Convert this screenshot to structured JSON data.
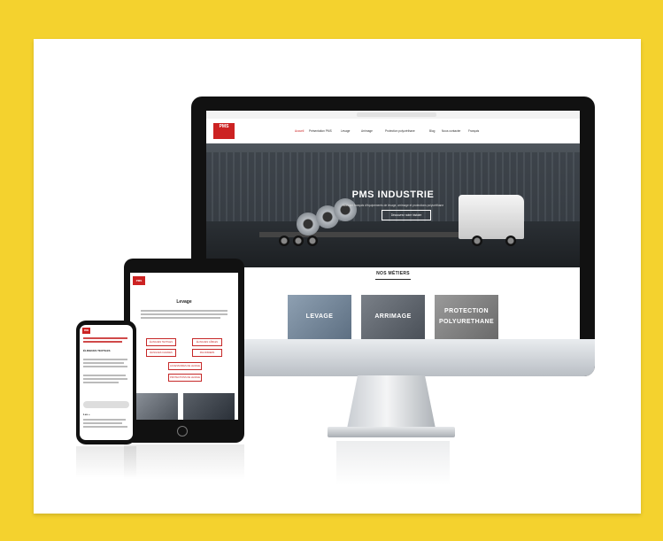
{
  "desktop": {
    "site": {
      "logo_text": "PMS",
      "nav": [
        "Accueil",
        "Présentation PMS",
        "Levage",
        "Arrimage",
        "Protection polyuréthane",
        "Blog",
        "Nous contacter",
        "Français"
      ],
      "hero_title": "PMS INDUSTRIE",
      "hero_subtitle": "fabricant français d'équipements de levage, arrimage et protections polyuréthane",
      "hero_button": "Découvrez notre histoire",
      "section_title": "NOS MÉTIERS",
      "tiles": [
        {
          "label": "LEVAGE",
          "label2": ""
        },
        {
          "label": "ARRIMAGE",
          "label2": ""
        },
        {
          "label": "PROTECTION",
          "label2": "POLYURETHANE"
        }
      ]
    }
  },
  "tablet": {
    "logo_text": "PMS",
    "page_title": "Levage",
    "buttons": [
      "ÉLINGUES TEXTILES",
      "ÉLINGUES CÂBLES",
      "ÉLINGUES CHAINES",
      "PALONNIERS",
      "ACCESSOIRES DE LEVAGE",
      "PROTECTIONS DE LEVAGE"
    ]
  },
  "phone": {
    "logo_text": "PMS",
    "heading": "ÉLINGUES TEXTILES",
    "footer_label": "Les +"
  },
  "colors": {
    "background": "#f4d22e",
    "brand_red": "#cc2222"
  }
}
